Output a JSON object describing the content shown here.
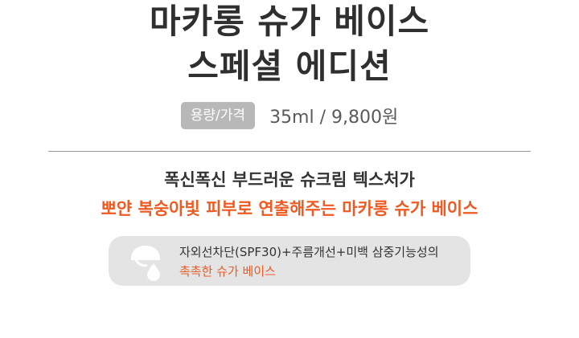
{
  "title": {
    "line1": "마카롱 슈가 베이스",
    "line2": "스페셜 에디션"
  },
  "spec": {
    "badge_label": "용량/가격",
    "value": "35ml / 9,800원"
  },
  "description": {
    "line1": "폭신폭신 부드러운 슈크림 텍스처가",
    "line2": "뽀얀 복숭아빛 피부로 연출해주는 마카롱 슈가 베이스"
  },
  "feature": {
    "icon": "cream-drop-icon",
    "line1": "자외선차단(SPF30)+주름개선+미백 삼중기능성의",
    "line2": "촉촉한 슈가 베이스"
  },
  "colors": {
    "accent": "#ee5a22",
    "title": "#2f2f2f",
    "badge": "#b8b8b8",
    "feature_bg": "#e4e4e4"
  }
}
